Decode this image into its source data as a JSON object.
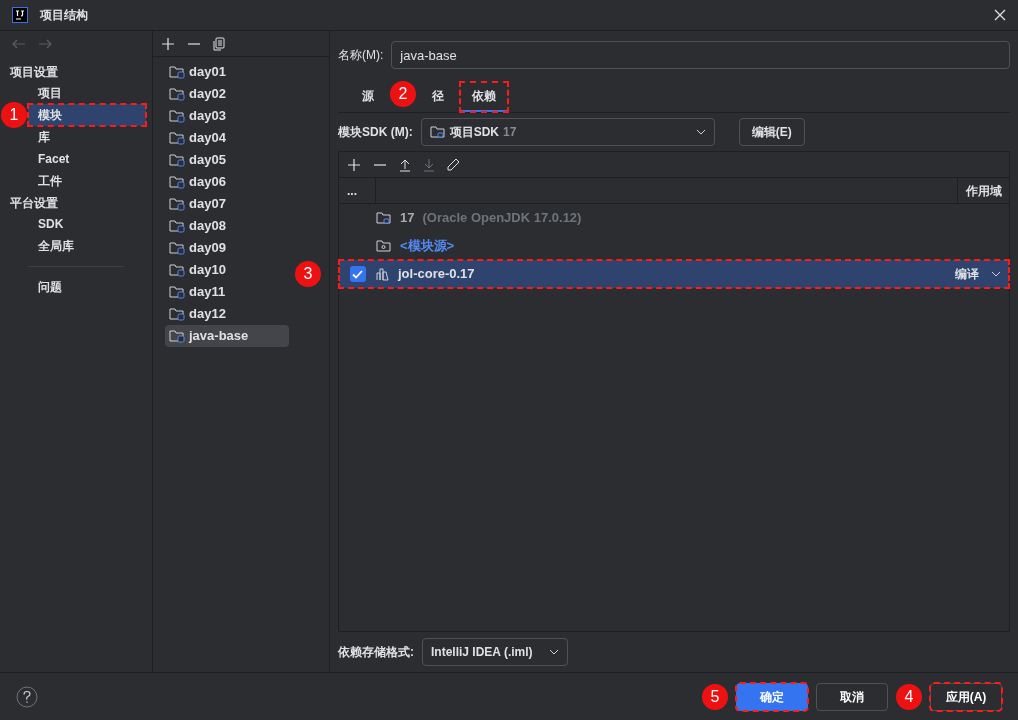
{
  "window": {
    "title": "项目结构"
  },
  "nav": {
    "sections": [
      {
        "title": "项目设置",
        "items": [
          {
            "label": "项目",
            "selected": false
          },
          {
            "label": "模块",
            "selected": true,
            "highlighted": true,
            "marker": "1"
          },
          {
            "label": "库",
            "selected": false
          },
          {
            "label": "Facet",
            "selected": false
          },
          {
            "label": "工件",
            "selected": false
          }
        ]
      },
      {
        "title": "平台设置",
        "items": [
          {
            "label": "SDK",
            "selected": false
          },
          {
            "label": "全局库",
            "selected": false
          }
        ]
      }
    ],
    "footer_items": [
      {
        "label": "问题",
        "selected": false
      }
    ]
  },
  "modules": [
    {
      "label": "day01",
      "selected": false
    },
    {
      "label": "day02",
      "selected": false
    },
    {
      "label": "day03",
      "selected": false
    },
    {
      "label": "day04",
      "selected": false
    },
    {
      "label": "day05",
      "selected": false
    },
    {
      "label": "day06",
      "selected": false
    },
    {
      "label": "day07",
      "selected": false
    },
    {
      "label": "day08",
      "selected": false
    },
    {
      "label": "day09",
      "selected": false
    },
    {
      "label": "day10",
      "selected": false
    },
    {
      "label": "day11",
      "selected": false
    },
    {
      "label": "day12",
      "selected": false
    },
    {
      "label": "java-base",
      "selected": true
    }
  ],
  "name_field": {
    "label": "名称(M):",
    "value": "java-base"
  },
  "tabs": [
    {
      "label": "源",
      "selected": false
    },
    {
      "label": "径",
      "selected": false,
      "marker": "2"
    },
    {
      "label": "依赖",
      "selected": true,
      "highlighted": true
    }
  ],
  "sdk": {
    "label": "模块SDK (M):",
    "value": "项目SDK",
    "version": "17",
    "edit_button": "编辑(E)"
  },
  "dependencies": {
    "columns": {
      "column_1": "...",
      "scope": "作用域"
    },
    "rows": [
      {
        "kind": "sdk",
        "name": "17",
        "detail": "(Oracle OpenJDK 17.0.12)"
      },
      {
        "kind": "module_source",
        "name": "<模块源>"
      },
      {
        "kind": "library",
        "name": "jol-core-0.17",
        "checked": true,
        "scope": "编译",
        "selected": true,
        "highlighted": true,
        "marker": "3"
      }
    ]
  },
  "storage_format": {
    "label": "依赖存储格式:",
    "value": "IntelliJ IDEA (.iml)"
  },
  "buttons": [
    {
      "label": "确定",
      "kind": "primary",
      "highlighted": true,
      "marker": "5"
    },
    {
      "label": "取消",
      "kind": "secondary"
    },
    {
      "label": "应用(A)",
      "kind": "secondary",
      "highlighted": true,
      "marker": "4"
    }
  ]
}
